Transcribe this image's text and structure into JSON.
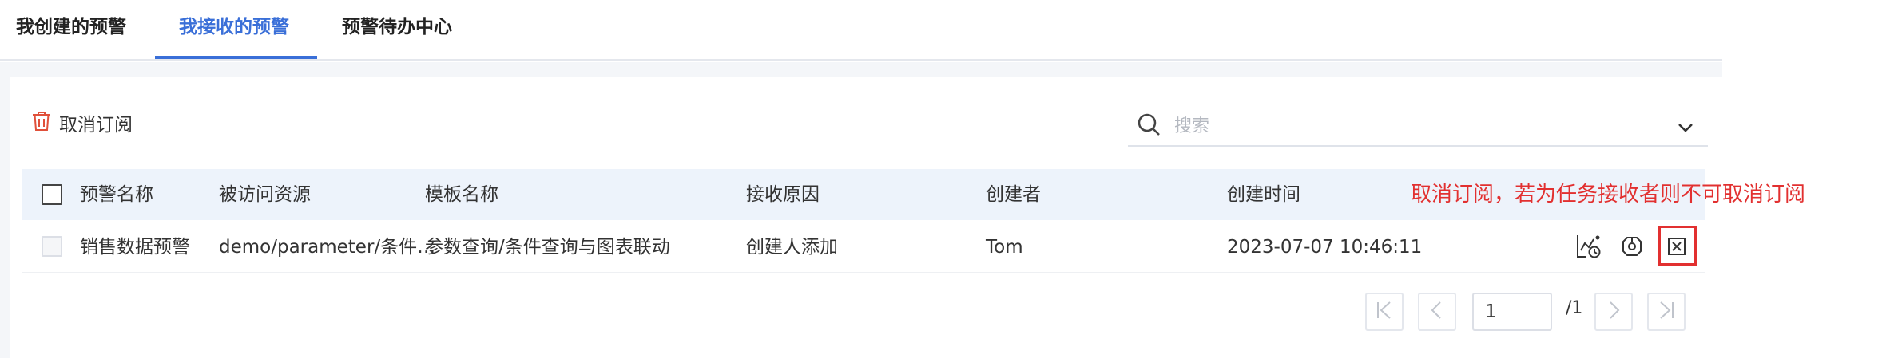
{
  "tabs": [
    {
      "label": "我创建的预警",
      "active": false
    },
    {
      "label": "我接收的预警",
      "active": true
    },
    {
      "label": "预警待办中心",
      "active": false
    }
  ],
  "toolbar": {
    "unsubscribe_label": "取消订阅"
  },
  "search": {
    "placeholder": "搜索",
    "value": ""
  },
  "table": {
    "headers": [
      "预警名称",
      "被访问资源",
      "模板名称",
      "接收原因",
      "创建者",
      "创建时间"
    ],
    "rows": [
      {
        "name": "销售数据预警",
        "resource": "demo/parameter/条件…",
        "template": "参数查询/条件查询与图表联动",
        "reason": "创建人添加",
        "creator": "Tom",
        "created_at": "2023-07-07 10:46:11"
      }
    ]
  },
  "annotation": "取消订阅，若为任务接收者则不可取消订阅",
  "pager": {
    "current": "1",
    "total_label": "/1"
  },
  "colors": {
    "accent": "#3a6fd8",
    "annotation": "#e23030",
    "unsubscribe_icon": "#e0503a"
  }
}
